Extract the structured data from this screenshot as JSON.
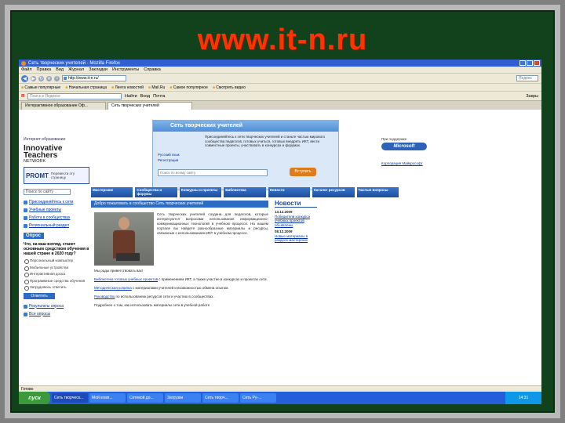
{
  "slide": {
    "title": "www.it-n.ru"
  },
  "browser": {
    "window_title": "Сеть творческих учителей - Mozilla Firefox",
    "menu": [
      "Файл",
      "Правка",
      "Вид",
      "Журнал",
      "Закладки",
      "Инструменты",
      "Справка"
    ],
    "url": "http://www.it-n.ru/",
    "search_placeholder": "Яндекс",
    "bookmarks": [
      "Самые популярные",
      "Начальная страница",
      "Лента новостей",
      "Mail.Ru",
      "Самое популярное",
      "Смотреть видео"
    ],
    "yandex_bar": {
      "logo": "Я",
      "input_placeholder": "Поиск в Яндексе",
      "buttons": [
        "Найти",
        "Вход",
        "Почта"
      ],
      "right_label": "Закры"
    },
    "tabs": [
      "Интерактивное образование Оф...",
      "Сеть творческих учителей"
    ],
    "status": "Готово",
    "taskbar": {
      "start": "пуск",
      "items": [
        "Сеть творческ...",
        "Мой комп...",
        "Сетевой до...",
        "Загрузки",
        "",
        "Сеть творч...",
        "Сеть Ру-...",
        "",
        "",
        ""
      ],
      "clock": "14:31"
    }
  },
  "page": {
    "left": {
      "logo_top": "Интернет-образование",
      "logo_main": "Innovative",
      "logo_main2": "Teachers",
      "logo_sub": "NETWORK",
      "promt": "PROMT",
      "promt_sub": "Перевести эту страницу",
      "promt_site": "Translate.Ru",
      "search_placeholder": "Поиск по сайту",
      "links": [
        "Присоединяйтесь к сети",
        "Учебные проекты",
        "Работа в сообществах",
        "Региональный раздел"
      ],
      "poll_header": "Опрос",
      "poll_question": "Что, на ваш взгляд, станет основным средством обучения в нашей стране в 2020 году?",
      "poll_options": [
        "Персональный компьютер",
        "Мобильные устройства",
        "Интерактивная доска",
        "Программные средства обучения",
        "Затрудняюсь ответить"
      ],
      "poll_button": "Ответить",
      "bottom_links": [
        "Результаты опроса",
        "Все опросы"
      ]
    },
    "banner": {
      "header": "Сеть творческих учителей",
      "text": "Присоединяйтесь к сети творческих учителей и станьте частью мирового сообщества педагогов, готовых учиться, готовых внедрять ИКТ, вести совместные проекты, участвовать в конкурсах и форумах.",
      "links": [
        "Русский язык",
        "Регистрация"
      ],
      "search_placeholder": "Поиск по всему сайту",
      "go_button": "Вступить"
    },
    "partner": {
      "caption": "При поддержке",
      "badge": "Microsoft",
      "link": "Корпорация Майкрософт"
    },
    "nav": [
      "Мастерские",
      "Сообщества и форумы",
      "Конкурсы и проекты",
      "Библиотека",
      "Новости",
      "Каталог ресурсов",
      "Частые вопросы"
    ],
    "greeting": "Добро пожаловать в сообщество Сеть творческих учителей",
    "intro": "Сеть творческих учителей создана для педагогов, которые интересуются вопросами использования информационно-коммуникационных технологий в учебном процессе. На нашем портале вы найдете разнообразные материалы и ресурсы, связанные с использованием ИКТ в учебном процессе.",
    "main_label": "Мы рады приветствовать вас!",
    "main_items": [
      {
        "link": "Библиотека готовых учебных проектов",
        "text": " с применением ИКТ, а также участие в конкурсах и проектах сети."
      },
      {
        "link": "Методическая копилка",
        "text": " с материалами учителей и возможностью обмена опытом."
      },
      {
        "link": "Руководство",
        "text": " по использованию ресурсов сети и участию в сообществах."
      }
    ],
    "main_footer": "Подробнее о том, как использовать материалы сети в учебной работе",
    "news_header": "Новости",
    "news": [
      {
        "date": "13.12.2009",
        "text": "Победители конкурса учебных проектов объявлены"
      },
      {
        "date": "08.12.2009",
        "text": "Новые материалы в разделе мастерских"
      }
    ]
  }
}
